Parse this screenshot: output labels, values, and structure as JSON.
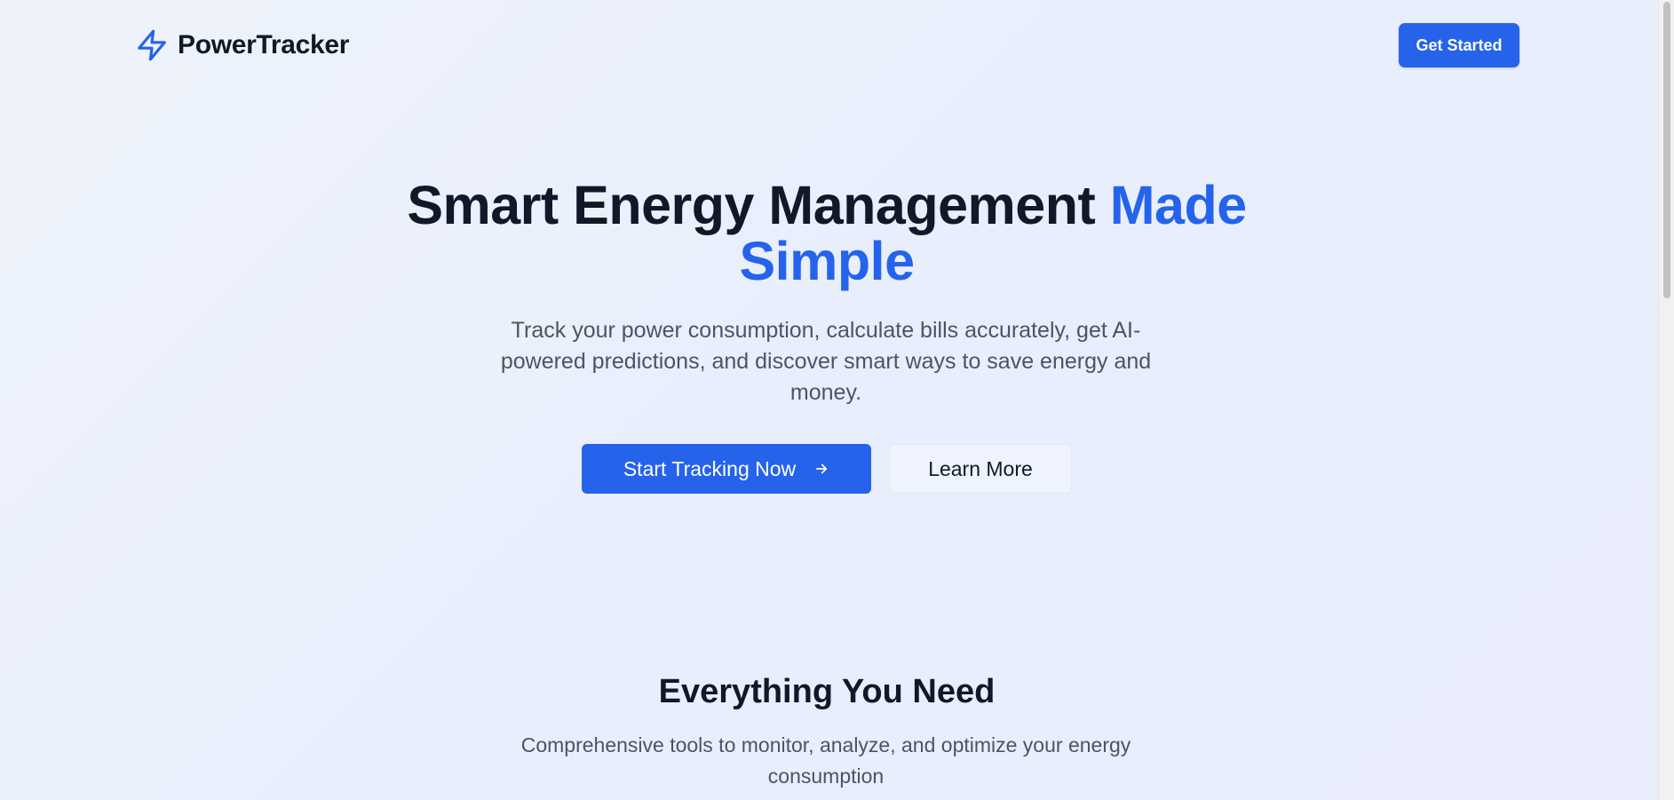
{
  "header": {
    "brand_name": "PowerTracker",
    "brand_icon": "lightning-bolt-icon",
    "get_started_label": "Get Started"
  },
  "hero": {
    "title_part1": "Smart Energy Management ",
    "title_accent_1": "Made",
    "title_accent_2": "Simple",
    "subtitle": "Track your power consumption, calculate bills accurately, get AI-powered predictions, and discover smart ways to save energy and money.",
    "primary_cta_label": "Start Tracking Now",
    "primary_cta_icon": "arrow-right-icon",
    "secondary_cta_label": "Learn More"
  },
  "features": {
    "title": "Everything You Need",
    "subtitle": "Comprehensive tools to monitor, analyze, and optimize your energy consumption"
  },
  "colors": {
    "accent": "#2563eb",
    "heading": "#111827",
    "body_text": "#4b5563",
    "background": "#eef3fb"
  }
}
